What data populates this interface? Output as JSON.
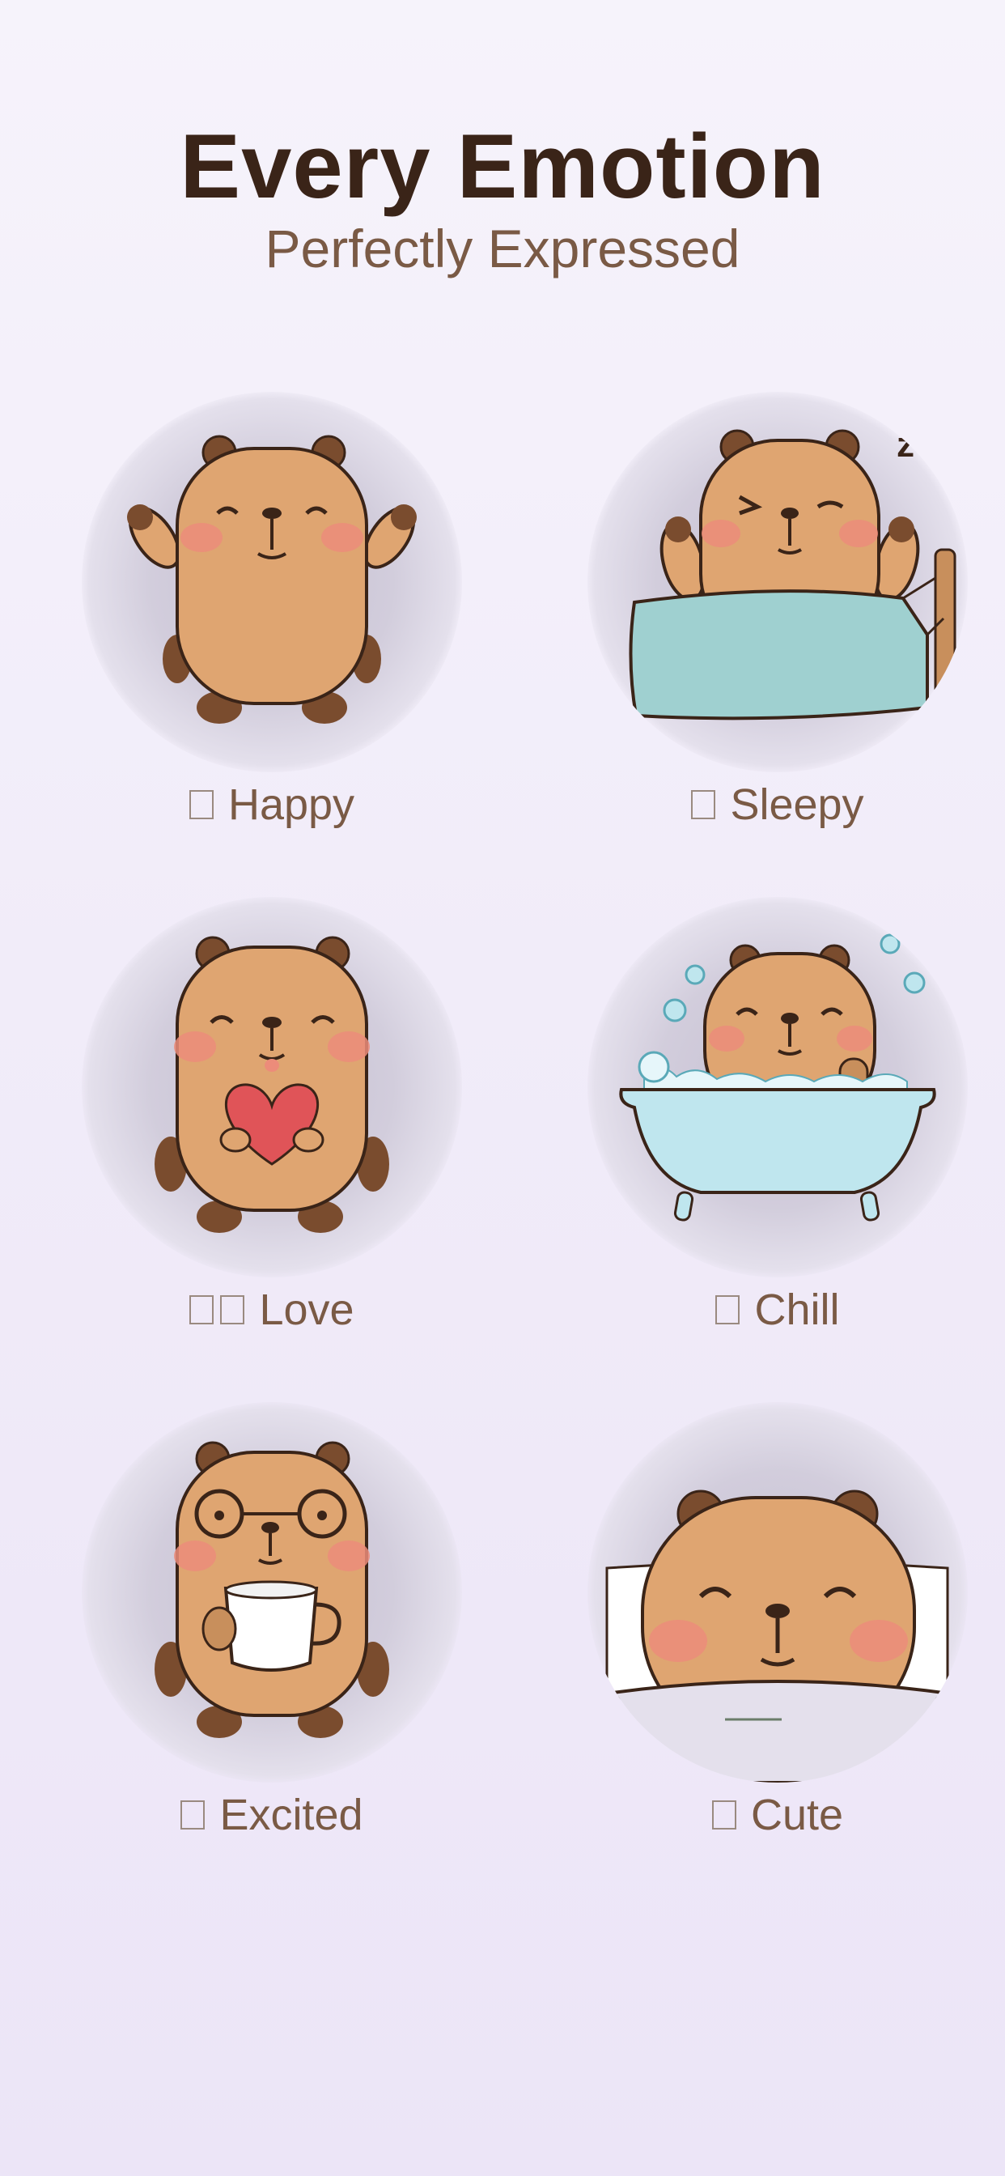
{
  "header": {
    "title": "Every Emotion",
    "subtitle": "Perfectly Expressed"
  },
  "stickers": [
    {
      "label": "Happy",
      "emoji_count": 1,
      "icon": "capybara-happy-icon"
    },
    {
      "label": "Sleepy",
      "emoji_count": 1,
      "icon": "capybara-sleepy-icon"
    },
    {
      "label": "Love",
      "emoji_count": 2,
      "icon": "capybara-love-icon"
    },
    {
      "label": "Chill",
      "emoji_count": 1,
      "icon": "capybara-chill-icon"
    },
    {
      "label": "Excited",
      "emoji_count": 1,
      "icon": "capybara-excited-icon"
    },
    {
      "label": "Cute",
      "emoji_count": 1,
      "icon": "capybara-cute-icon"
    }
  ],
  "colors": {
    "title": "#3a2418",
    "subtitle": "#7a5a45",
    "fur": "#dfa571",
    "fur_dark": "#7a4c2e",
    "blush": "#ec8c7a",
    "blanket": "#9fd0d0",
    "tub": "#bfe6ee",
    "heart": "#e05458"
  }
}
